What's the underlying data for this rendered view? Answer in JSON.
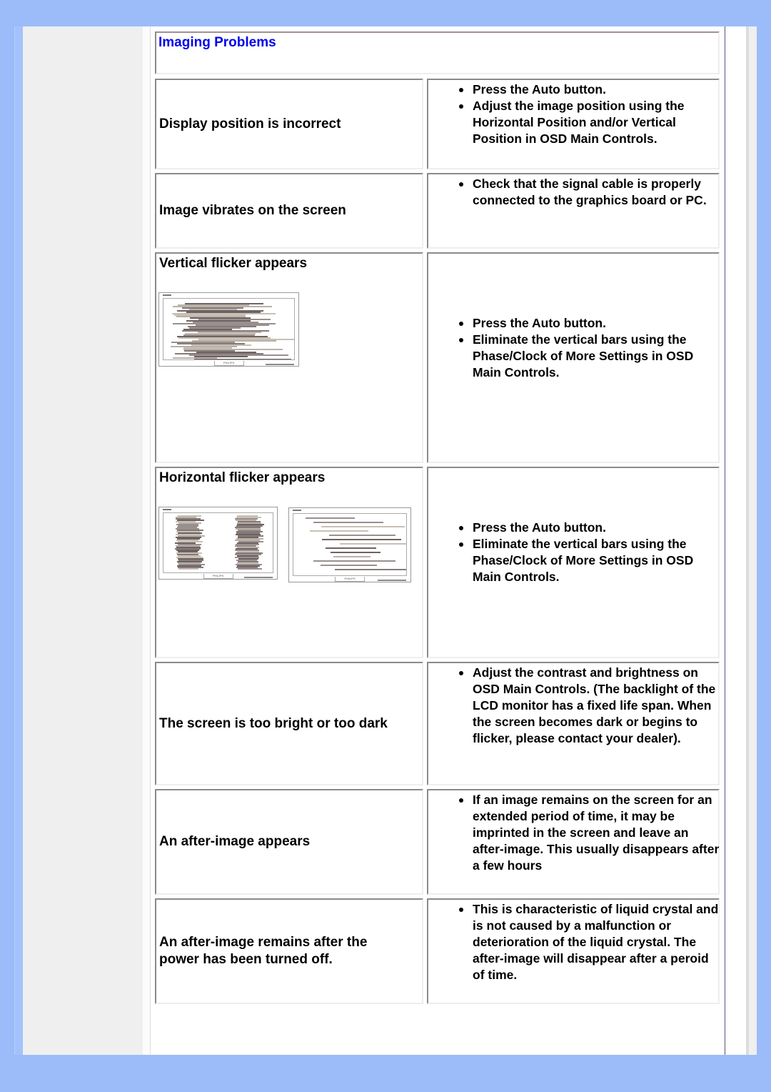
{
  "page": {
    "title": "Imaging Problems",
    "colors": {
      "background": "#9bbcf9",
      "title": "#0000ee",
      "text": "#000000"
    }
  },
  "rows": [
    {
      "problem": "Display position is incorrect",
      "solutions": [
        "Press the Auto button.",
        "Adjust the image position using the Horizontal Position and/or Vertical Position in OSD Main Controls."
      ]
    },
    {
      "problem": "Image vibrates on the screen",
      "solutions": [
        "Check that the signal cable is properly connected to the graphics board or PC."
      ]
    },
    {
      "problem": "Vertical flicker appears",
      "image": "monitor-vertical-flicker-illustration",
      "solutions": [
        "Press the Auto button.",
        "Eliminate the vertical bars using the Phase/Clock of More Settings in OSD Main Controls."
      ]
    },
    {
      "problem": "Horizontal flicker appears",
      "images": [
        "monitor-horizontal-flicker-illustration-1",
        "monitor-horizontal-flicker-illustration-2"
      ],
      "solutions": [
        "Press the Auto button.",
        "Eliminate the vertical bars using the Phase/Clock of More Settings in OSD Main Controls."
      ]
    },
    {
      "problem": "The screen is too bright or too dark",
      "solutions": [
        "Adjust the contrast and brightness on OSD Main Controls. (The backlight of the LCD monitor has a fixed life span. When the screen becomes dark or begins to flicker, please contact your dealer)."
      ]
    },
    {
      "problem": "An after-image appears",
      "solutions": [
        "If an image remains on the screen for an extended period of time, it may be imprinted in the screen and leave an after-image. This usually disappears after a few hours"
      ]
    },
    {
      "problem": "An after-image remains after the power has been turned off.",
      "solutions": [
        "This is characteristic of liquid crystal and is not caused by a malfunction or deterioration of the liquid crystal. The after-image will disappear after a peroid of time."
      ]
    }
  ],
  "monitor_brand": "PHILIPS"
}
